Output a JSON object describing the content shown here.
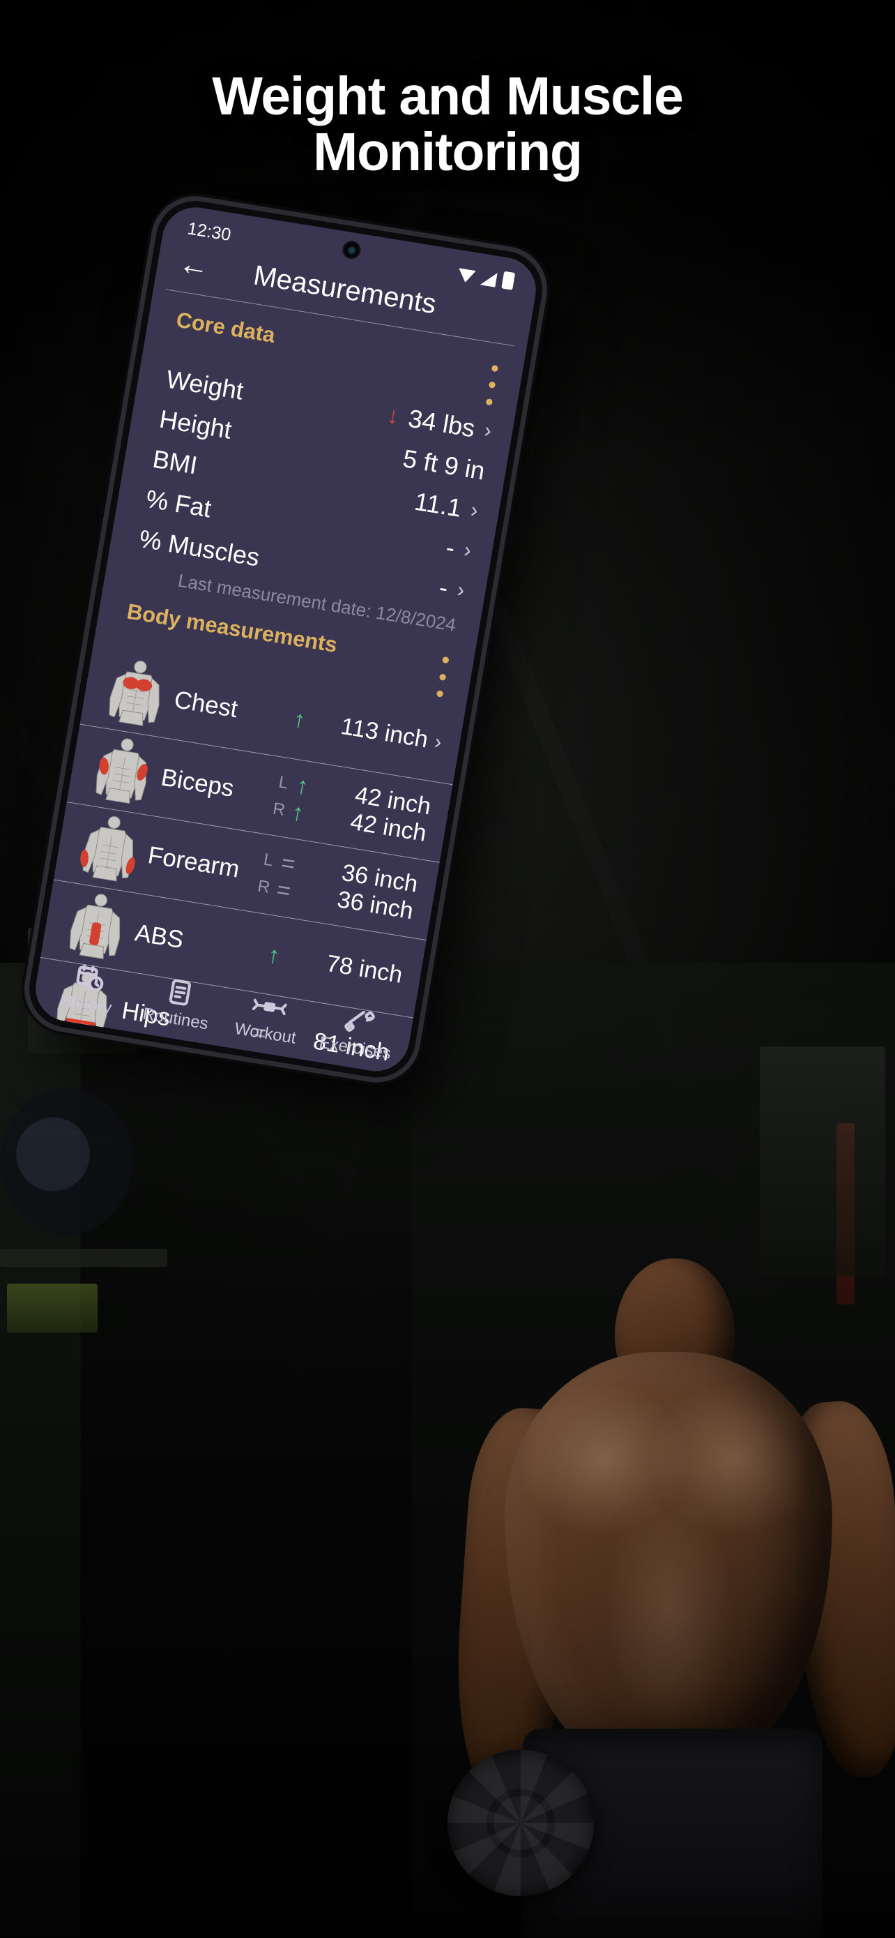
{
  "headline": {
    "line1": "Weight and Muscle",
    "line2": "Monitoring"
  },
  "colors": {
    "accent_gold": "#ddb25f",
    "screen_bg": "#3a3550",
    "trend_up": "#4fc98a",
    "trend_down": "#d8453e",
    "trend_flat": "#9a95a8",
    "muted_text": "#8e89a0"
  },
  "phone": {
    "status_bar": {
      "time": "12:30",
      "icons": [
        "wifi-icon",
        "signal-icon",
        "battery-icon"
      ]
    },
    "app_bar": {
      "back_label": "←",
      "title": "Measurements"
    },
    "core_data": {
      "title": "Core data",
      "menu_icon": "kebab-menu-icon",
      "rows": [
        {
          "label": "Weight",
          "trend": "down",
          "trend_glyph": "↓",
          "value": "34 lbs",
          "chevron": "›"
        },
        {
          "label": "Height",
          "trend": "",
          "trend_glyph": "",
          "value": "5 ft 9 in",
          "chevron": ""
        },
        {
          "label": "BMI",
          "trend": "",
          "trend_glyph": "",
          "value": "11.1",
          "chevron": "›"
        },
        {
          "label": "% Fat",
          "trend": "",
          "trend_glyph": "",
          "value": "-",
          "chevron": "›"
        },
        {
          "label": "% Muscles",
          "trend": "",
          "trend_glyph": "",
          "value": "-",
          "chevron": "›"
        }
      ],
      "last_measurement": "Last measurement date: 12/8/2024"
    },
    "body_measurements": {
      "title": "Body measurements",
      "menu_icon": "kebab-menu-icon",
      "rows": [
        {
          "name": "Chest",
          "thumb": "chest-anatomy-icon",
          "chevron": "›",
          "lines": [
            {
              "side": "",
              "trend": "up",
              "trend_glyph": "↑",
              "value": "113 inch"
            }
          ]
        },
        {
          "name": "Biceps",
          "thumb": "biceps-anatomy-icon",
          "chevron": "",
          "lines": [
            {
              "side": "L",
              "trend": "up",
              "trend_glyph": "↑",
              "value": "42 inch"
            },
            {
              "side": "R",
              "trend": "up",
              "trend_glyph": "↑",
              "value": "42 inch"
            }
          ]
        },
        {
          "name": "Forearm",
          "thumb": "forearm-anatomy-icon",
          "chevron": "",
          "lines": [
            {
              "side": "L",
              "trend": "flat",
              "trend_glyph": "=",
              "value": "36 inch"
            },
            {
              "side": "R",
              "trend": "flat",
              "trend_glyph": "=",
              "value": "36 inch"
            }
          ]
        },
        {
          "name": "ABS",
          "thumb": "abs-anatomy-icon",
          "chevron": "",
          "lines": [
            {
              "side": "",
              "trend": "up",
              "trend_glyph": "↑",
              "value": "78 inch"
            }
          ]
        },
        {
          "name": "Hips",
          "thumb": "hips-anatomy-icon",
          "chevron": "",
          "lines": [
            {
              "side": "",
              "trend": "flat",
              "trend_glyph": "=",
              "value": "81 inch"
            }
          ]
        }
      ]
    },
    "bottom_nav": [
      {
        "label": "History",
        "icon": "calendar-clock-icon"
      },
      {
        "label": "Routines",
        "icon": "list-document-icon"
      },
      {
        "label": "Workout",
        "icon": "dumbbell-wings-icon"
      },
      {
        "label": "Exercises",
        "icon": "barbell-icon"
      }
    ]
  }
}
